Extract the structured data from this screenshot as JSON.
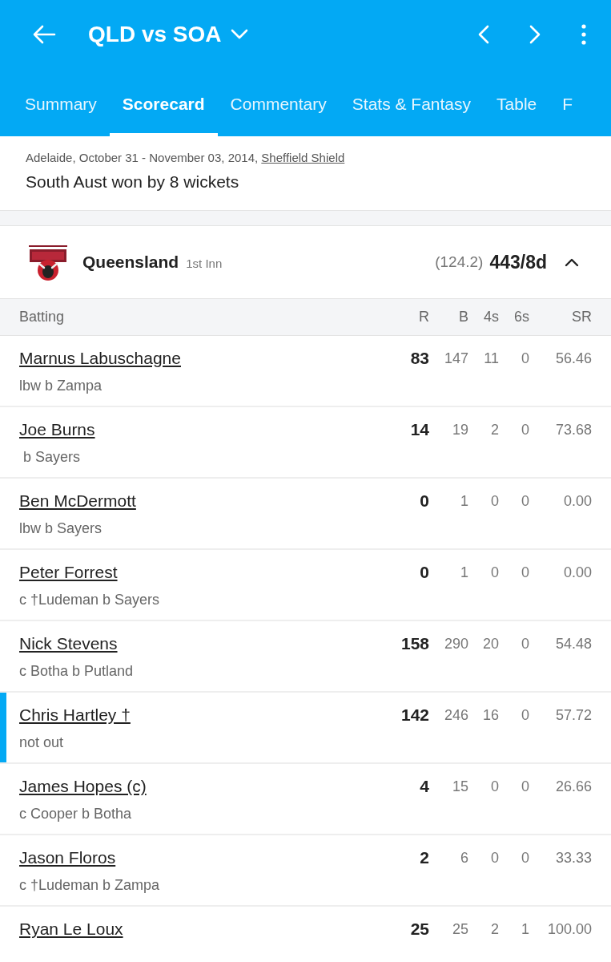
{
  "header": {
    "title": "QLD vs SOA"
  },
  "tabs": [
    {
      "label": "Summary",
      "selected": false
    },
    {
      "label": "Scorecard",
      "selected": true
    },
    {
      "label": "Commentary",
      "selected": false
    },
    {
      "label": "Stats & Fantasy",
      "selected": false
    },
    {
      "label": "Table",
      "selected": false
    },
    {
      "label": "F",
      "selected": false
    }
  ],
  "match_info": {
    "venue_dates": "Adelaide, October 31 - November 03, 2014, ",
    "series": "Sheffield Shield",
    "result": "South Aust won by 8 wickets"
  },
  "innings": {
    "team": "Queensland",
    "innings_label": "1st Inn",
    "overs": "(124.2)",
    "score": "443/8d",
    "expanded": true
  },
  "table": {
    "columns": [
      "Batting",
      "R",
      "B",
      "4s",
      "6s",
      "SR"
    ],
    "rows": [
      {
        "batter": "Marnus Labuschagne",
        "dismissal": "lbw b Zampa",
        "runs": "83",
        "balls": "147",
        "fours": "11",
        "sixes": "0",
        "strike_rate": "56.46",
        "not_out": false
      },
      {
        "batter": "Joe Burns",
        "dismissal": " b Sayers",
        "runs": "14",
        "balls": "19",
        "fours": "2",
        "sixes": "0",
        "strike_rate": "73.68",
        "not_out": false
      },
      {
        "batter": "Ben McDermott",
        "dismissal": "lbw b Sayers",
        "runs": "0",
        "balls": "1",
        "fours": "0",
        "sixes": "0",
        "strike_rate": "0.00",
        "not_out": false
      },
      {
        "batter": "Peter Forrest",
        "dismissal": "c †Ludeman b Sayers",
        "runs": "0",
        "balls": "1",
        "fours": "0",
        "sixes": "0",
        "strike_rate": "0.00",
        "not_out": false
      },
      {
        "batter": "Nick Stevens",
        "dismissal": "c Botha b Putland",
        "runs": "158",
        "balls": "290",
        "fours": "20",
        "sixes": "0",
        "strike_rate": "54.48",
        "not_out": false
      },
      {
        "batter": "Chris Hartley †",
        "dismissal": "not out",
        "runs": "142",
        "balls": "246",
        "fours": "16",
        "sixes": "0",
        "strike_rate": "57.72",
        "not_out": true
      },
      {
        "batter": "James Hopes (c)",
        "dismissal": "c Cooper b Botha",
        "runs": "4",
        "balls": "15",
        "fours": "0",
        "sixes": "0",
        "strike_rate": "26.66",
        "not_out": false
      },
      {
        "batter": "Jason Floros",
        "dismissal": "c †Ludeman b Zampa",
        "runs": "2",
        "balls": "6",
        "fours": "0",
        "sixes": "0",
        "strike_rate": "33.33",
        "not_out": false
      },
      {
        "batter": "Ryan Le Loux",
        "runs": "25",
        "balls": "25",
        "fours": "2",
        "sixes": "1",
        "strike_rate": "100.00",
        "not_out": false
      }
    ]
  }
}
